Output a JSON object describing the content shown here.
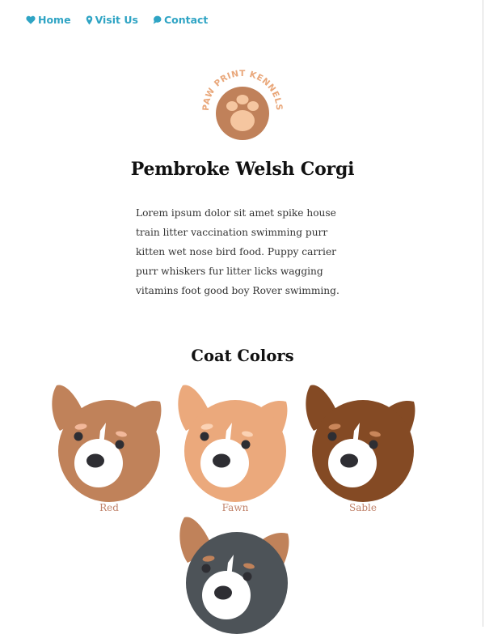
{
  "nav": {
    "items": [
      {
        "label": "Home",
        "icon": "heart-icon"
      },
      {
        "label": "Visit Us",
        "icon": "map-pin-icon"
      },
      {
        "label": "Contact",
        "icon": "chat-bubble-icon"
      }
    ],
    "color": "#2fa4c4"
  },
  "logo": {
    "text": "PAW PRINT KENNELS",
    "color": "#c0815a",
    "pad_color": "#f5c6a0"
  },
  "page_title": "Pembroke Welsh Corgi",
  "intro": "Lorem ipsum dolor sit amet spike house train litter vaccination swimming purr kitten wet nose bird food. Puppy carrier purr whiskers fur litter licks wagging vitamins foot good boy Rover swimming.",
  "coat_section": {
    "title": "Coat Colors",
    "colors": [
      {
        "label": "Red",
        "fur": "#c0825a"
      },
      {
        "label": "Fawn",
        "fur": "#eba97c"
      },
      {
        "label": "Sable",
        "fur": "#844a24"
      },
      {
        "label": "",
        "fur": "#4d5358",
        "ears": "#c0825a"
      }
    ],
    "label_color": "#c0826a"
  }
}
